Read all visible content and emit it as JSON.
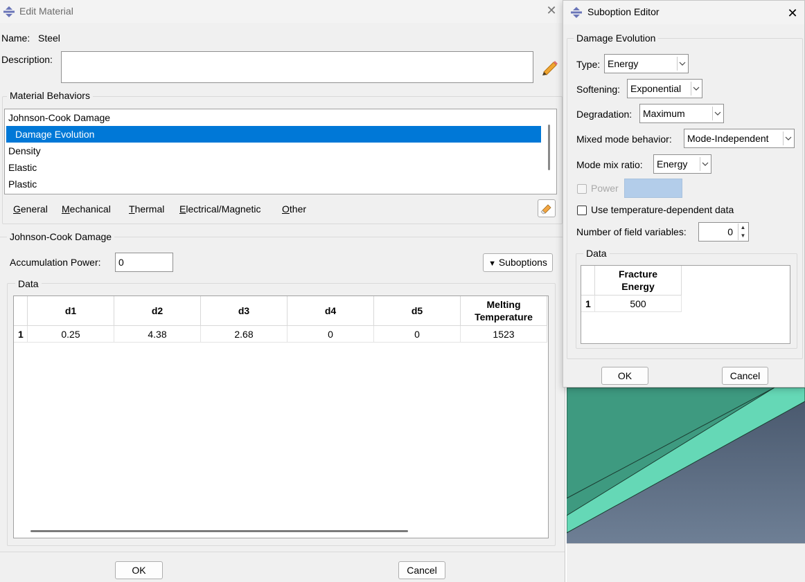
{
  "edit_material": {
    "title": "Edit Material",
    "name_label": "Name:",
    "name_value": "Steel",
    "description_label": "Description:",
    "description_value": "",
    "behaviors_group": "Material Behaviors",
    "behaviors": [
      "Johnson-Cook Damage",
      "Damage Evolution",
      "Density",
      "Elastic",
      "Plastic"
    ],
    "selected_behavior": "Damage Evolution",
    "menus": [
      {
        "mnemonic": "G",
        "rest": "eneral"
      },
      {
        "mnemonic": "M",
        "rest": "echanical"
      },
      {
        "mnemonic": "T",
        "rest": "hermal"
      },
      {
        "mnemonic": "E",
        "rest": "lectrical/Magnetic"
      },
      {
        "mnemonic": "O",
        "rest": "ther"
      }
    ],
    "section_title": "Johnson-Cook Damage",
    "accumulation_label": "Accumulation Power:",
    "accumulation_value": "0",
    "suboptions_label": "Suboptions",
    "data_group": "Data",
    "table": {
      "headers": [
        "d1",
        "d2",
        "d3",
        "d4",
        "d5",
        "Melting\nTemperature"
      ],
      "rows": [
        {
          "num": "1",
          "cells": [
            "0.25",
            "4.38",
            "2.68",
            "0",
            "0",
            "1523"
          ]
        }
      ]
    },
    "ok_label": "OK",
    "cancel_label": "Cancel"
  },
  "suboption_editor": {
    "title": "Suboption Editor",
    "group_title": "Damage Evolution",
    "type_label": "Type:",
    "type_value": "Energy",
    "softening_label": "Softening:",
    "softening_value": "Exponential",
    "degradation_label": "Degradation:",
    "degradation_value": "Maximum",
    "mixed_mode_label": "Mixed mode behavior:",
    "mixed_mode_value": "Mode-Independent",
    "mode_mix_label": "Mode mix ratio:",
    "mode_mix_value": "Energy",
    "power_label": "Power",
    "temp_dependent_label": "Use temperature-dependent data",
    "field_vars_label": "Number of field variables:",
    "field_vars_value": "0",
    "data_group": "Data",
    "table": {
      "headers": [
        "Fracture\nEnergy"
      ],
      "rows": [
        {
          "num": "1",
          "cells": [
            "500"
          ]
        }
      ]
    },
    "ok_label": "OK",
    "cancel_label": "Cancel"
  },
  "colors": {
    "selection": "#0078d7",
    "power_field_disabled": "#b3cdea",
    "viewport_bg": "#56677d",
    "part_face": "#65d8b6"
  }
}
